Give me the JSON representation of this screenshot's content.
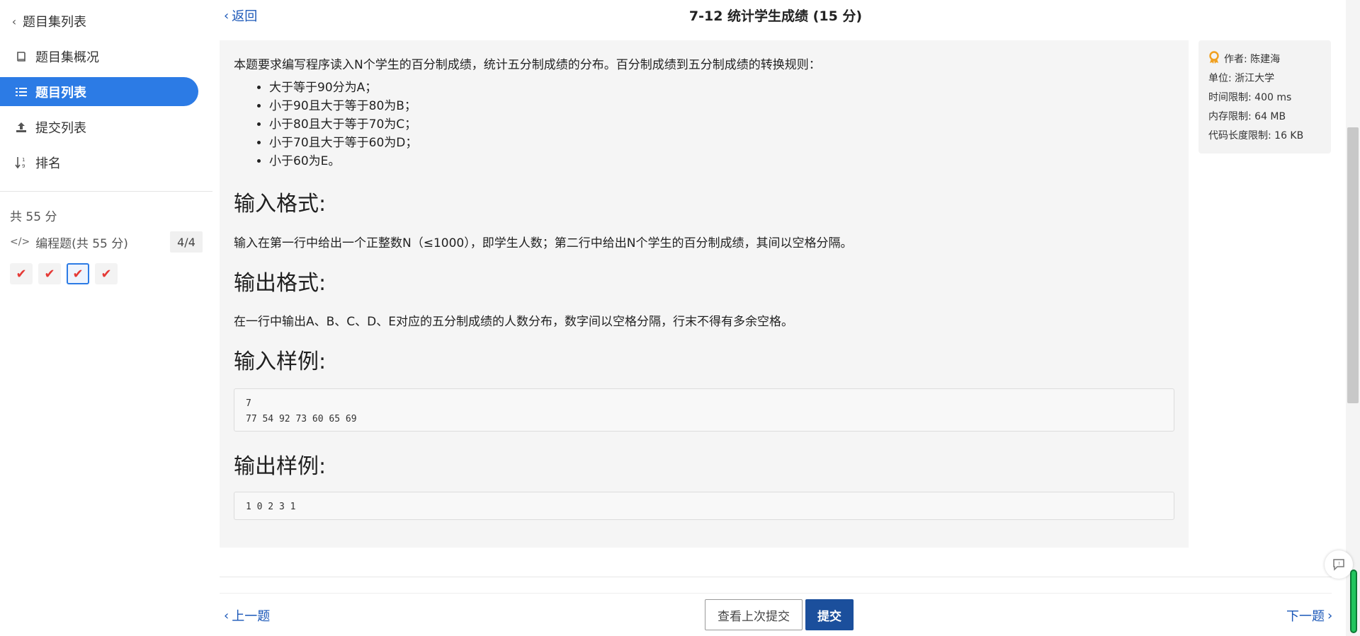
{
  "sidebar": {
    "back_label": "题目集列表",
    "items": [
      {
        "label": "题目集概况",
        "icon": "book-icon"
      },
      {
        "label": "题目列表",
        "icon": "list-icon",
        "active": true
      },
      {
        "label": "提交列表",
        "icon": "upload-icon"
      },
      {
        "label": "排名",
        "icon": "sort-numeric-icon"
      }
    ],
    "total_score": "共 55 分",
    "category_label": "编程题(共 55 分)",
    "category_count": "4/4",
    "checks": [
      "✔",
      "✔",
      "✔",
      "✔"
    ]
  },
  "header": {
    "back_label": "返回",
    "title": "7-12 统计学生成绩 (15 分)"
  },
  "problem": {
    "intro": "本题要求编写程序读入N个学生的百分制成绩，统计五分制成绩的分布。百分制成绩到五分制成绩的转换规则：",
    "rules": [
      "大于等于90分为A；",
      "小于90且大于等于80为B；",
      "小于80且大于等于70为C；",
      "小于70且大于等于60为D；",
      "小于60为E。"
    ],
    "input_heading": "输入格式:",
    "input_text": "输入在第一行中给出一个正整数N（≤1000），即学生人数；第二行中给出N个学生的百分制成绩，其间以空格分隔。",
    "output_heading": "输出格式:",
    "output_text": "在一行中输出A、B、C、D、E对应的五分制成绩的人数分布，数字间以空格分隔，行末不得有多余空格。",
    "sample_input_heading": "输入样例:",
    "sample_input": "7\n77 54 92 73 60 65 69",
    "sample_output_heading": "输出样例:",
    "sample_output": "1 0 2 3 1"
  },
  "info": {
    "author": "作者: 陈建海",
    "unit": "单位: 浙江大学",
    "time_limit": "时间限制: 400 ms",
    "memory_limit": "内存限制: 64 MB",
    "code_limit": "代码长度限制: 16 KB"
  },
  "footer": {
    "prev_label": "上一题",
    "next_label": "下一题",
    "last_submit_label": "查看上次提交",
    "submit_label": "提交"
  },
  "colors": {
    "accent": "#2c7be5",
    "link": "#1a57b8",
    "submit": "#1b4f9c",
    "check": "#e53935"
  }
}
